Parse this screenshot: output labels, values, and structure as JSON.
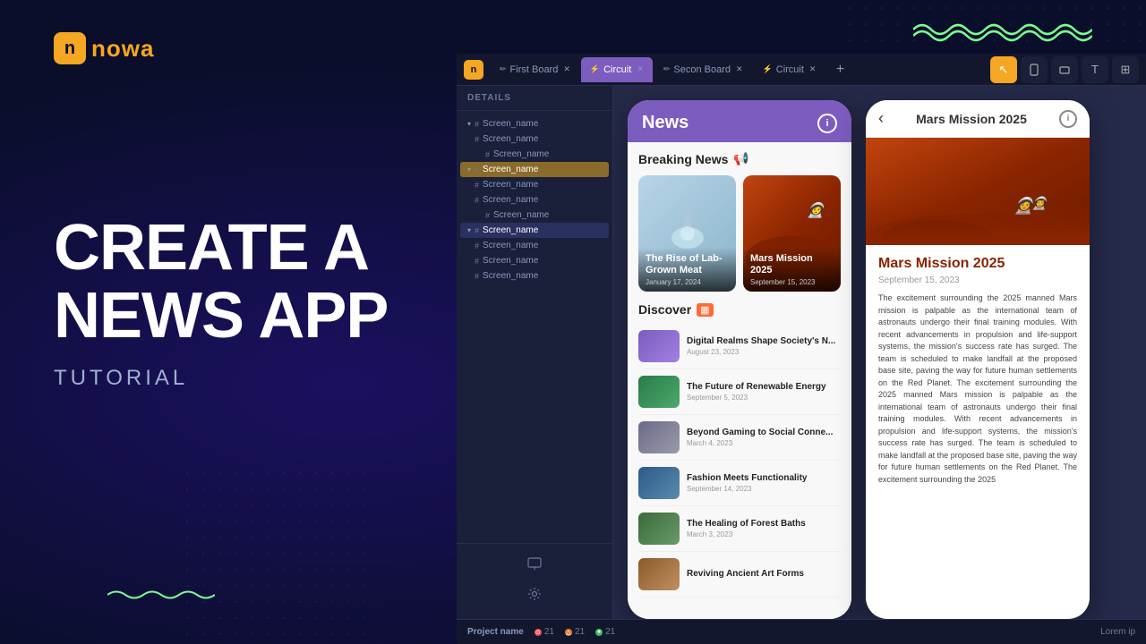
{
  "logo": {
    "icon": "n",
    "text": "nowa"
  },
  "hero": {
    "line1": "CREATE A",
    "line2": "NEWS APP",
    "subtitle": "TUTORIAL"
  },
  "tabs": [
    {
      "label": "First Board",
      "icon": "✏",
      "active": false
    },
    {
      "label": "Circuit",
      "icon": "⚡",
      "active": true
    },
    {
      "label": "Secon Board",
      "icon": "✏",
      "active": false
    },
    {
      "label": "Circuit",
      "icon": "⚡",
      "active": false
    }
  ],
  "sidebar": {
    "header": "DETAILS",
    "items": [
      {
        "label": "Screen_name",
        "level": 0,
        "collapsed": false,
        "selected": false
      },
      {
        "label": "Screen_name",
        "level": 1,
        "selected": false
      },
      {
        "label": "Screen_name",
        "level": 2,
        "selected": false
      },
      {
        "label": "Screen_name",
        "level": 0,
        "collapsed": false,
        "selected": true
      },
      {
        "label": "Screen_name",
        "level": 1,
        "selected": false
      },
      {
        "label": "Screen_name",
        "level": 1,
        "selected": false
      },
      {
        "label": "Screen_name",
        "level": 2,
        "selected": false
      },
      {
        "label": "Screen_name",
        "level": 0,
        "collapsed": false,
        "selected": true,
        "alt": true
      },
      {
        "label": "Screen_name",
        "level": 1,
        "selected": false
      },
      {
        "label": "Screen_name",
        "level": 1,
        "selected": false
      },
      {
        "label": "Screen_name",
        "level": 1,
        "selected": false
      }
    ]
  },
  "news_phone": {
    "title": "News",
    "breaking_news": "Breaking News",
    "cards": [
      {
        "title": "The Rise of Lab-Grown Meat",
        "date": "January 17, 2024"
      },
      {
        "title": "Mars Mission 2025",
        "date": "September 15, 2023"
      }
    ],
    "discover": "Discover",
    "list_items": [
      {
        "title": "Digital Realms Shape Society's N...",
        "date": "August 23, 2023"
      },
      {
        "title": "The Future of Renewable Energy",
        "date": "September 5, 2023"
      },
      {
        "title": "Beyond Gaming to Social Conne...",
        "date": "March 4, 2023"
      },
      {
        "title": "Fashion Meets Functionality",
        "date": "September 14, 2023"
      },
      {
        "title": "The Healing of Forest Baths",
        "date": "March 3, 2023"
      },
      {
        "title": "Reviving Ancient Art Forms",
        "date": ""
      }
    ]
  },
  "detail_phone": {
    "back": "‹",
    "title": "Mars Mission 2025",
    "article_title": "Mars Mission 2025",
    "date": "September 15, 2023",
    "body": "The excitement surrounding the 2025 manned Mars mission is palpable as the international team of astronauts undergo their final training modules. With recent advancements in propulsion and life-support systems, the mission's success rate has surged. The team is scheduled to make landfall at the proposed base site, paving the way for future human settlements on the Red Planet. The excitement surrounding the 2025 manned Mars mission is palpable as the international team of astronauts undergo their final training modules. With recent advancements in propulsion and life-support systems, the mission's success rate has surged. The team is scheduled to make landfall at the proposed base site, paving the way for future human settlements on the Red Planet. The excitement surrounding the 2025"
  },
  "status_bar": {
    "project": "Project name",
    "badge1": "21",
    "badge2": "21",
    "badge3": "21",
    "lorem": "Lorem ip"
  },
  "toolbar": {
    "cursor": "↖",
    "phone": "☐",
    "rect": "▭",
    "text": "T",
    "grid": "⊞"
  }
}
